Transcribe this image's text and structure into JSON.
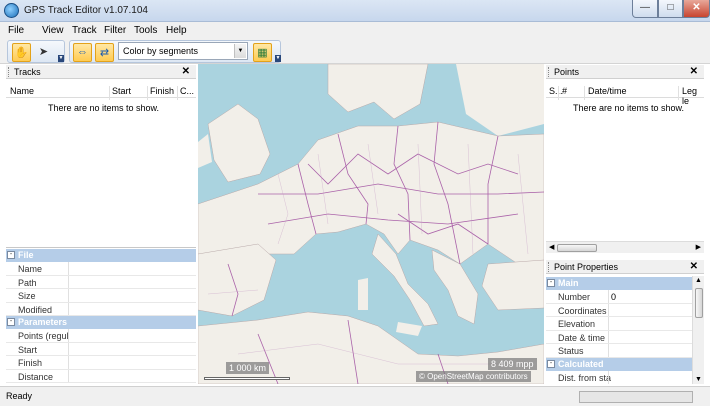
{
  "window": {
    "title": "GPS Track Editor v1.07.104"
  },
  "menu": [
    "File",
    "View",
    "Track",
    "Filter",
    "Tools",
    "Help"
  ],
  "toolbar": {
    "color_mode": "Color by segments"
  },
  "tracks_panel": {
    "title": "Tracks",
    "columns": [
      "Name",
      "Start",
      "Finish",
      "C..."
    ],
    "empty_text": "There are no items to show."
  },
  "track_properties": {
    "categories": [
      {
        "name": "File",
        "rows": [
          "Name",
          "Path",
          "Size",
          "Modified"
        ]
      },
      {
        "name": "Parameters",
        "rows": [
          "Points (regul",
          "Start",
          "Finish",
          "Distance"
        ]
      }
    ]
  },
  "points_panel": {
    "title": "Points",
    "columns": [
      "S...",
      "#",
      "Date/time",
      "Leg le"
    ],
    "empty_text": "There are no items to show."
  },
  "point_properties": {
    "title": "Point Properties",
    "categories": [
      {
        "name": "Main",
        "rows": [
          {
            "key": "Number",
            "value": "0"
          },
          {
            "key": "Coordinates",
            "value": ""
          },
          {
            "key": "Elevation",
            "value": ""
          },
          {
            "key": "Date & time",
            "value": ""
          },
          {
            "key": "Status",
            "value": ""
          }
        ]
      },
      {
        "name": "Calculated",
        "rows": [
          {
            "key": "Dist. from sta",
            "value": ""
          }
        ]
      }
    ]
  },
  "map": {
    "scale_label": "1 000 km",
    "mpp_label": "8 409 mpp",
    "attribution": "© OpenStreetMap contributors"
  },
  "status": {
    "text": "Ready"
  },
  "colors": {
    "sea": "#aad3df",
    "land": "#f2efe9",
    "borders": "#9e4a9e",
    "category": "#b5cde8"
  }
}
